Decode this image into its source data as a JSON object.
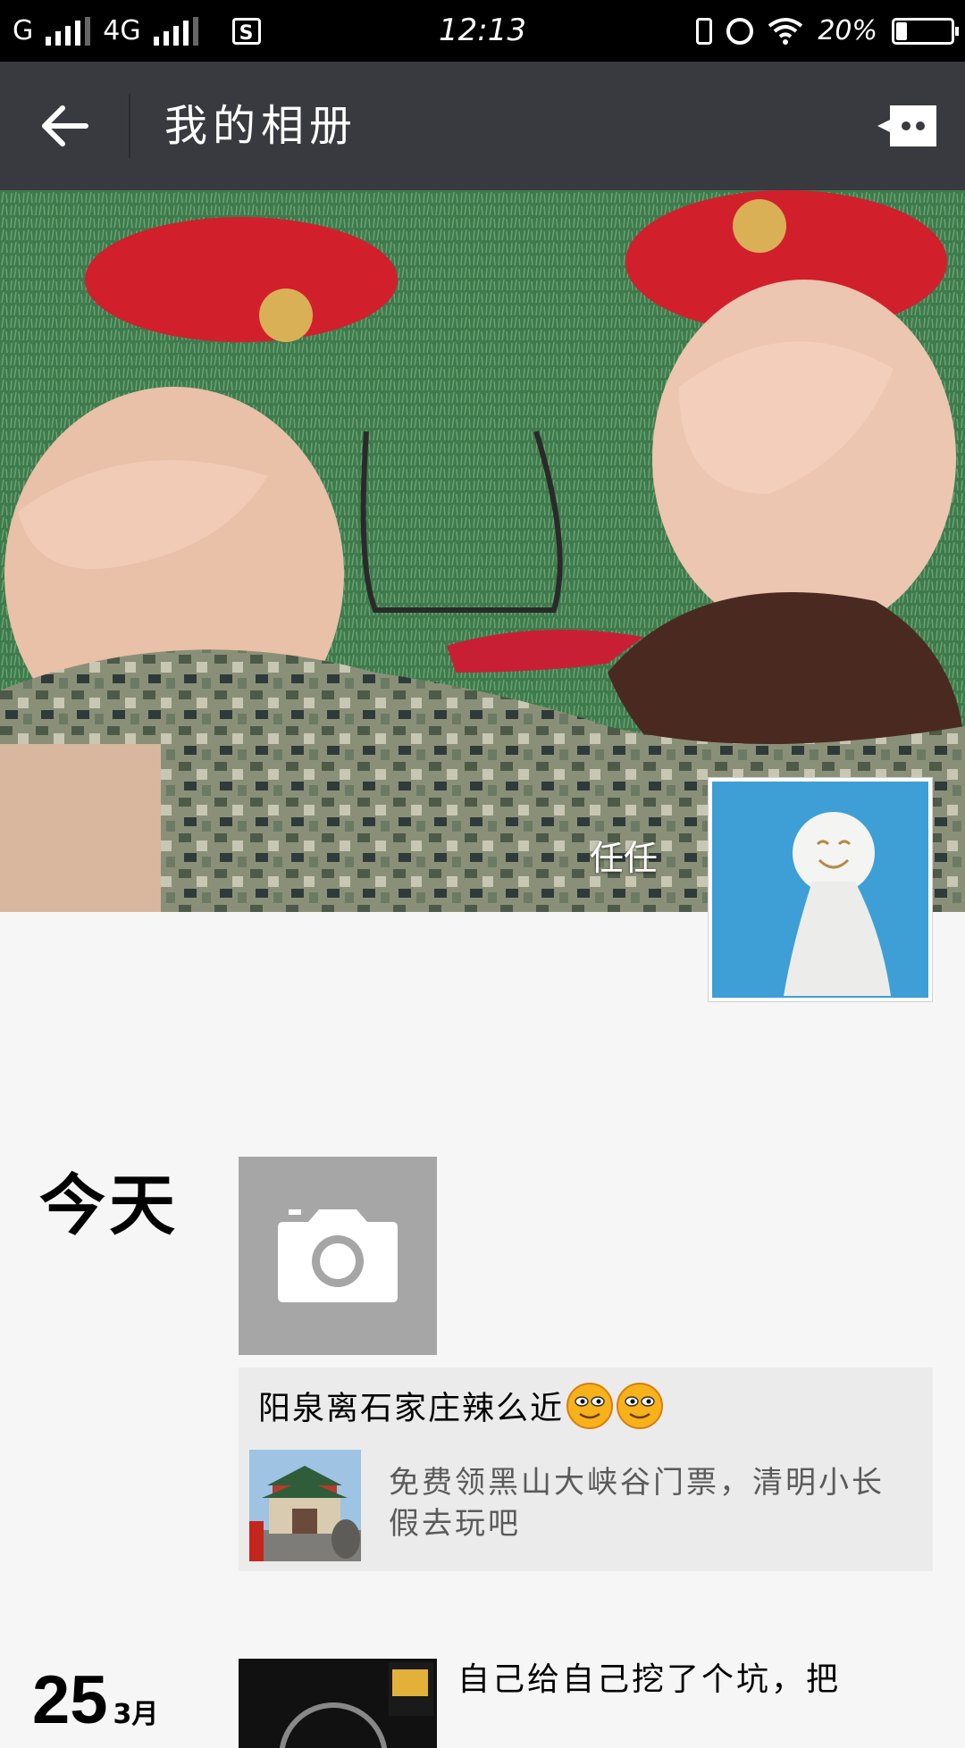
{
  "status_bar": {
    "carrier": "G",
    "network": "4G",
    "time": "12:13",
    "battery": "20%",
    "battery_level": 0.2,
    "icons": [
      "signal-icon",
      "sim-icon",
      "vibrate-icon",
      "alarm-icon",
      "wifi-icon",
      "battery-icon"
    ]
  },
  "header": {
    "title": "我的相册",
    "back_icon": "back-arrow-icon",
    "more_icon": "more-icon"
  },
  "profile": {
    "name": "任任"
  },
  "feed": [
    {
      "date_label": "今天",
      "camera_icon": "camera-icon",
      "share": {
        "title": "阳泉离石家庄辣么近",
        "emoji": [
          "grinning-emoji",
          "grinning-emoji"
        ],
        "description": "免费领黑山大峡谷门票，清明小长假去玩吧"
      }
    },
    {
      "day": "25",
      "month": "3月",
      "text": "自己给自己挖了个坑，把"
    }
  ],
  "colors": {
    "status_bar": "#000000",
    "app_bar": "#393a3f",
    "background": "#f6f6f6",
    "card": "#ebebeb",
    "camera_tile": "#a6a6a6"
  }
}
